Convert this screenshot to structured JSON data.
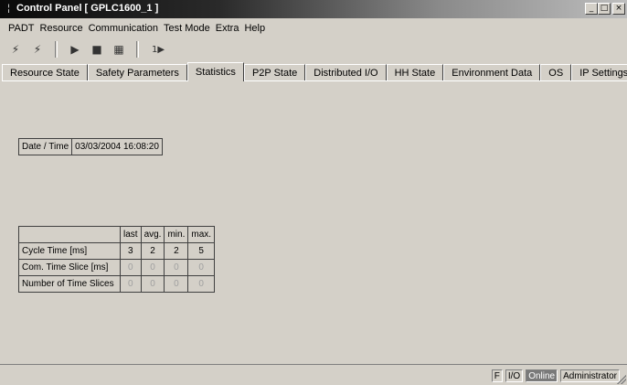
{
  "window": {
    "title": "Control Panel [ GPLC1600_1 ]",
    "app_icon": "plc-app-icon",
    "controls": {
      "minimize": "_",
      "maximize": "□",
      "close": "×"
    }
  },
  "menu": {
    "items": [
      "PADT",
      "Resource",
      "Communication",
      "Test Mode",
      "Extra",
      "Help"
    ]
  },
  "toolbar": {
    "buttons": [
      {
        "icon": "connect-icon",
        "glyph": "⚡"
      },
      {
        "icon": "disconnect-icon",
        "glyph": "⚡"
      },
      {
        "icon": "run-icon",
        "glyph": "▶"
      },
      {
        "icon": "stop-icon",
        "glyph": "■"
      },
      {
        "icon": "download-icon",
        "glyph": "▦"
      },
      {
        "icon": "single-step-icon",
        "glyph": "1▶"
      }
    ]
  },
  "tabs": [
    {
      "label": "Resource State",
      "active": false
    },
    {
      "label": "Safety Parameters",
      "active": false
    },
    {
      "label": "Statistics",
      "active": true
    },
    {
      "label": "P2P State",
      "active": false
    },
    {
      "label": "Distributed I/O",
      "active": false
    },
    {
      "label": "HH State",
      "active": false
    },
    {
      "label": "Environment Data",
      "active": false
    },
    {
      "label": "OS",
      "active": false
    },
    {
      "label": "IP Settings",
      "active": false
    }
  ],
  "statistics": {
    "date_time_label": "Date / Time",
    "date_time_value": "03/03/2004 16:08:20",
    "columns": [
      "last",
      "avg.",
      "min.",
      "max."
    ],
    "rows": [
      {
        "label": "Cycle Time [ms]",
        "values": [
          "3",
          "2",
          "2",
          "5"
        ],
        "dim": false
      },
      {
        "label": "Com. Time Slice [ms]",
        "values": [
          "0",
          "0",
          "0",
          "0"
        ],
        "dim": true
      },
      {
        "label": "Number of Time Slices",
        "values": [
          "0",
          "0",
          "0",
          "0"
        ],
        "dim": true
      }
    ]
  },
  "status": {
    "f": "F",
    "io": "I/O",
    "online": "Online",
    "user": "Administrator"
  }
}
